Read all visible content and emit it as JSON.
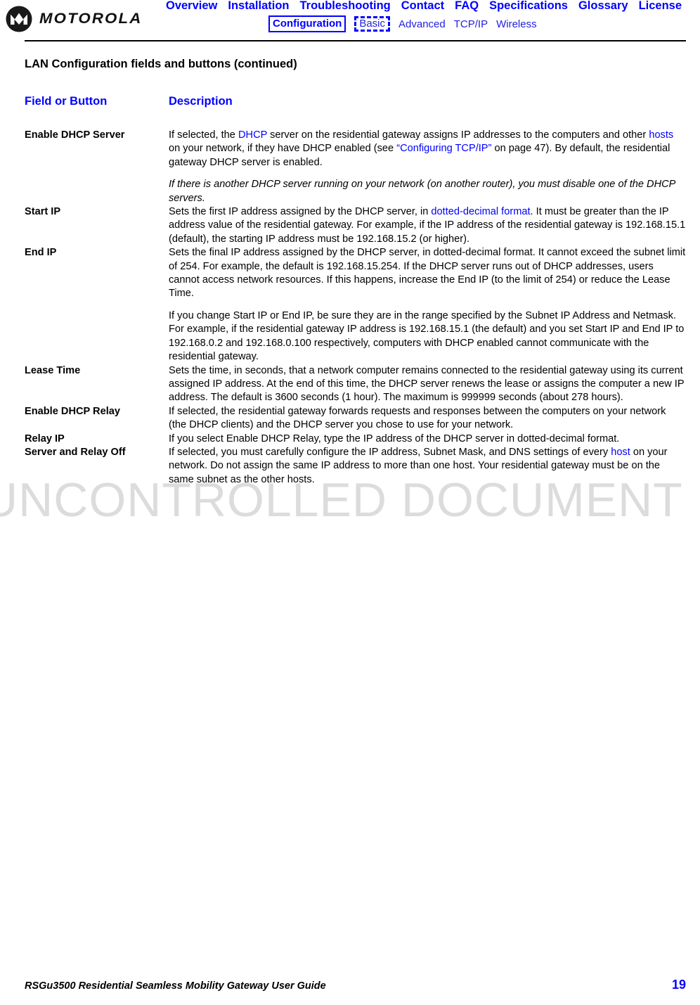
{
  "header": {
    "logo_text": "MOTOROLA",
    "logo_icon": "motorola-batwing-logo",
    "nav_primary": [
      "Overview",
      "Installation",
      "Troubleshooting",
      "Contact",
      "FAQ",
      "Specifications",
      "Glossary",
      "License"
    ],
    "nav_secondary": [
      "Configuration",
      "Basic",
      "Advanced",
      "TCP/IP",
      "Wireless"
    ]
  },
  "watermark": "UNCONTROLLED DOCUMENT",
  "page": {
    "title": "LAN Configuration fields and buttons (continued)",
    "columns": {
      "field": "Field or Button",
      "description": "Description"
    }
  },
  "rows": [
    {
      "label": "Enable DHCP Server",
      "indent": false,
      "paragraphs": [
        {
          "italic": false,
          "parts": [
            {
              "t": "If selected, the ",
              "link": false
            },
            {
              "t": "DHCP",
              "link": true
            },
            {
              "t": " server on the residential gateway assigns IP addresses to the computers and other ",
              "link": false
            },
            {
              "t": "hosts",
              "link": true
            },
            {
              "t": " on your network, if they have DHCP enabled (see ",
              "link": false
            },
            {
              "t": "“Configuring TCP/IP”",
              "link": true
            },
            {
              "t": " on page 47). By default, the residential gateway DHCP server is enabled.",
              "link": false
            }
          ]
        },
        {
          "italic": true,
          "parts": [
            {
              "t": "If there is another DHCP server running on your network (on another router), you must disable one of the DHCP servers.",
              "link": false
            }
          ]
        }
      ]
    },
    {
      "label": "Start IP",
      "indent": true,
      "paragraphs": [
        {
          "italic": false,
          "parts": [
            {
              "t": "Sets the first IP address assigned by the DHCP server, in ",
              "link": false
            },
            {
              "t": "dotted-decimal format",
              "link": true
            },
            {
              "t": ". It must be greater than the IP address value of the residential gateway. For example, if the IP address of the residential gateway is 192.168.15.1 (default), the starting IP address must be 192.168.15.2 (or higher).",
              "link": false
            }
          ]
        }
      ]
    },
    {
      "label": "End IP",
      "indent": true,
      "paragraphs": [
        {
          "italic": false,
          "parts": [
            {
              "t": "Sets the final IP address assigned by the DHCP server, in dotted-decimal format. It cannot exceed the subnet limit of 254. For example, the default is 192.168.15.254. If the DHCP server runs out of DHCP addresses, users cannot access network resources. If this happens, increase the End IP (to the limit of 254) or reduce the Lease Time.",
              "link": false
            }
          ]
        },
        {
          "italic": false,
          "parts": [
            {
              "t": "If you change Start IP or End IP, be sure they are in the range specified by the Subnet IP Address and Netmask. For example, if the residential gateway IP address is 192.168.15.1 (the default) and you set Start IP and End IP to 192.168.0.2 and 192.168.0.100 respectively, computers with DHCP enabled cannot communicate with the residential gateway.",
              "link": false
            }
          ]
        }
      ]
    },
    {
      "label": "Lease Time",
      "indent": true,
      "paragraphs": [
        {
          "italic": false,
          "parts": [
            {
              "t": "Sets the time, in seconds, that a network computer remains connected to the residential gateway using its current assigned IP address. At the end of this time, the DHCP server renews the lease or assigns the computer a new IP address. The default is 3600 seconds (1 hour). The maximum is 999999 seconds (about 278 hours).",
              "link": false
            }
          ]
        }
      ]
    },
    {
      "label": "Enable DHCP Relay",
      "indent": false,
      "paragraphs": [
        {
          "italic": false,
          "parts": [
            {
              "t": "If selected, the residential gateway forwards requests and responses between the computers on your network (the DHCP clients) and the DHCP server you chose to use for your network.",
              "link": false
            }
          ]
        }
      ]
    },
    {
      "label": "Relay IP",
      "indent": true,
      "paragraphs": [
        {
          "italic": false,
          "parts": [
            {
              "t": "If you select Enable DHCP Relay, type the IP address of the DHCP server in dotted-decimal format.",
              "link": false
            }
          ]
        }
      ]
    },
    {
      "label": "Server and Relay Off",
      "indent": false,
      "paragraphs": [
        {
          "italic": false,
          "parts": [
            {
              "t": "If selected, you must carefully configure the IP address, Subnet Mask, and DNS settings of every ",
              "link": false
            },
            {
              "t": "host",
              "link": true
            },
            {
              "t": " on your network. Do not assign the same IP address to more than one host. Your residential gateway must be on the same subnet as the other hosts.",
              "link": false
            }
          ]
        }
      ]
    }
  ],
  "footer": {
    "text": "RSGu3500 Residential Seamless Mobility Gateway User Guide",
    "page_number": "19"
  }
}
